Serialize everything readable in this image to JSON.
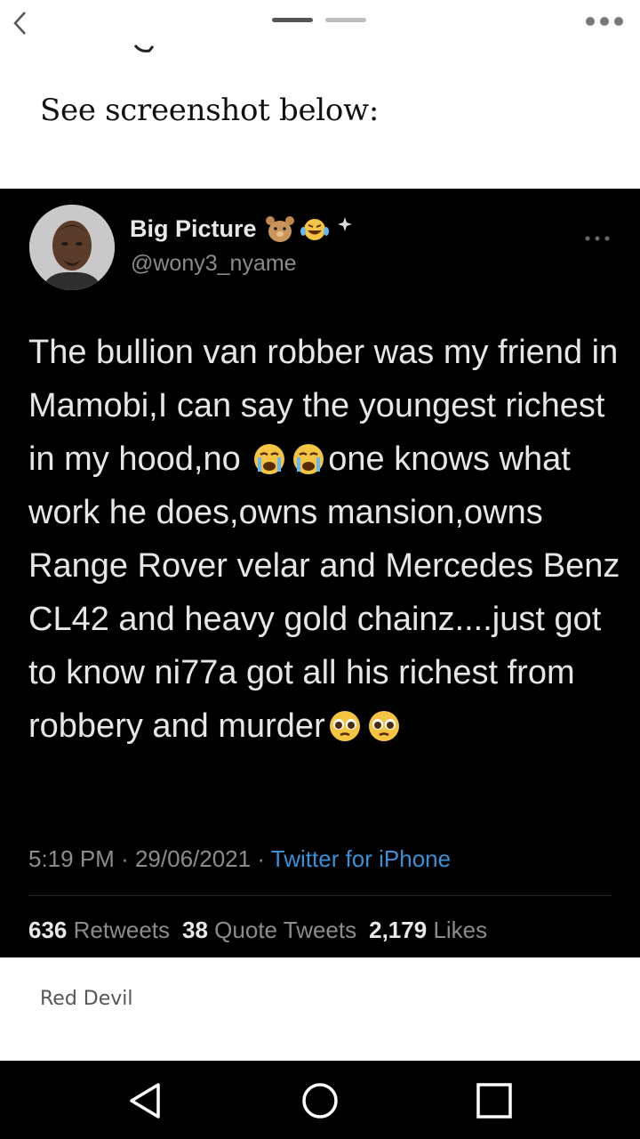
{
  "header": {
    "back_icon": "chevron-left-icon",
    "more_icon": "more-horizontal-icon"
  },
  "post": {
    "caption": "See screenshot below:",
    "author": "Red Devil"
  },
  "tweet": {
    "display_name": "Big Picture",
    "name_emojis": [
      "teddy-bear-emoji",
      "laughing-tears-emoji",
      "sparkle-emoji"
    ],
    "handle": "@wony3_nyame",
    "text_part1": "The bullion van robber was my friend in Mamobi,I can say the youngest richest in my hood,no",
    "text_part2": "one knows what work he does,owns mansion,owns Range Rover velar and Mercedes Benz CL42 and heavy gold chainz....just got to know ni77a got all his richest from robbery and murder",
    "time": "5:19 PM",
    "date": "29/06/2021",
    "source": "Twitter for iPhone",
    "separator": "·",
    "retweets_count": "636",
    "retweets_label": "Retweets",
    "quotes_count": "38",
    "quotes_label": "Quote Tweets",
    "likes_count": "2,179",
    "likes_label": "Likes"
  },
  "navbar": {
    "back_icon": "triangle-back-icon",
    "home_icon": "circle-home-icon",
    "recents_icon": "square-recents-icon"
  },
  "colors": {
    "tweet_bg": "#000000",
    "link": "#3a8fd6",
    "muted": "#8c8c8c"
  }
}
